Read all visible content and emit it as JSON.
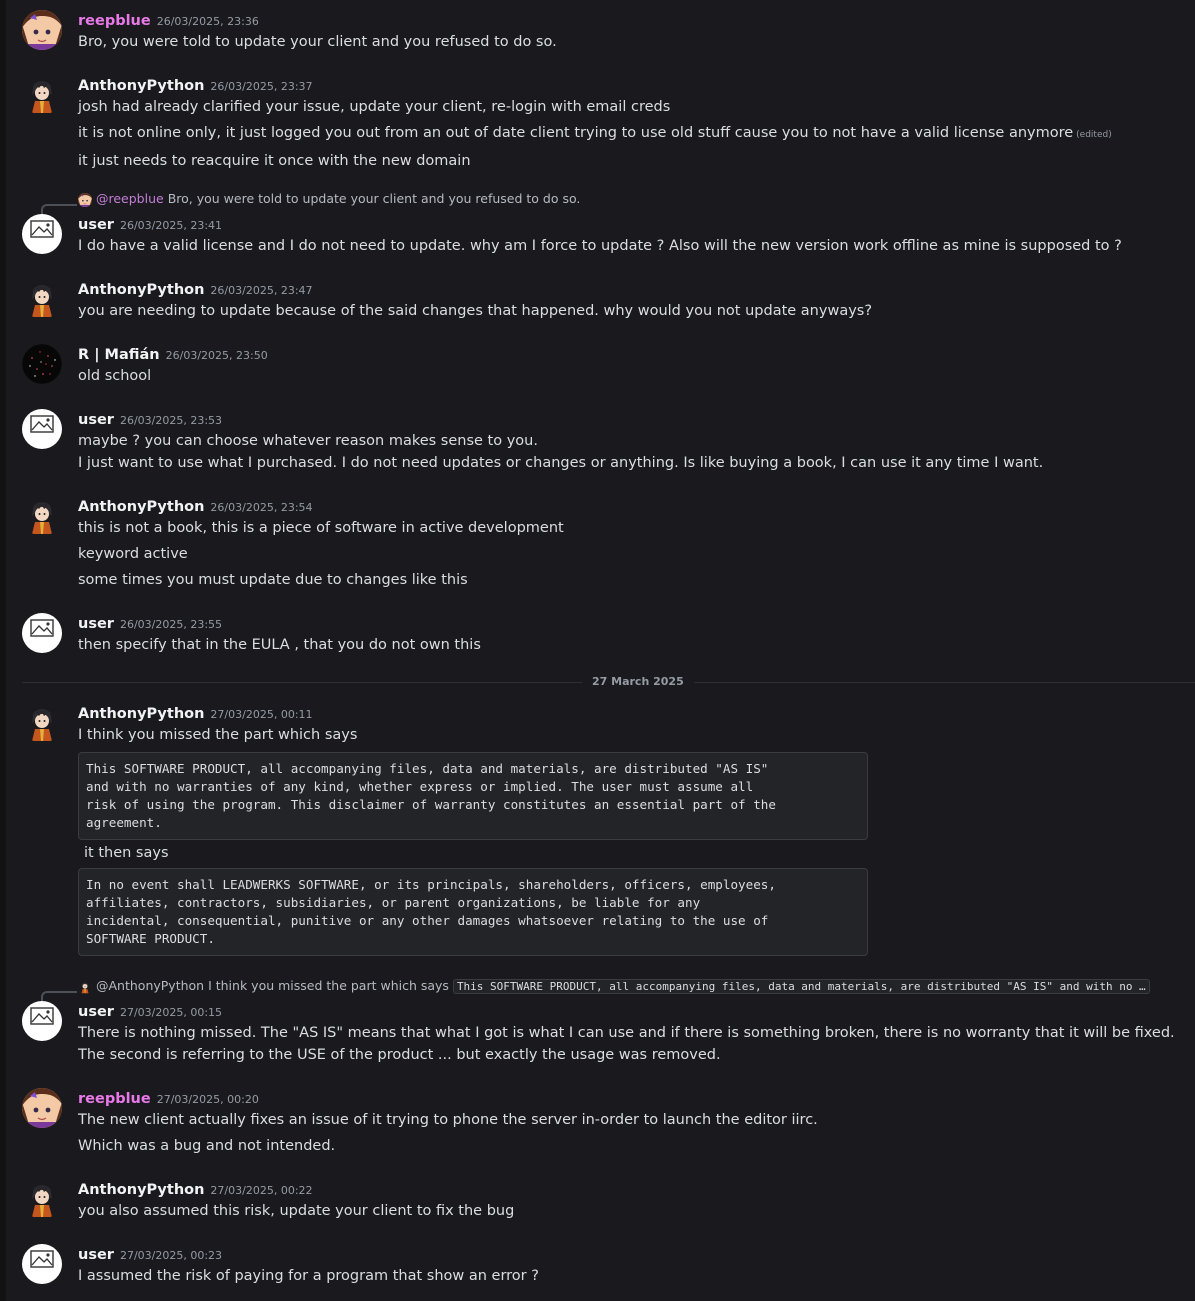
{
  "users": {
    "reepblue": "reepblue",
    "anthony": "AnthonyPython",
    "user": "user",
    "mafian": "R | Mafián"
  },
  "no_image_text": "No image available",
  "messages": [
    {
      "ts": "26/03/2025, 23:36",
      "lines": [
        "Bro, you were told to update your client and you refused to do so."
      ]
    },
    {
      "ts": "26/03/2025, 23:37",
      "lines": [
        "josh had already clarified your issue, update your client, re-login with email creds",
        "it is not online only, it just logged you out from an out of date client trying to use old stuff cause you to not have a valid license anymore",
        "it just needs to reacquire it once with the new domain"
      ],
      "edited": "(edited)"
    },
    {
      "ts": "26/03/2025, 23:41",
      "reply_to": "@reepblue",
      "reply_text": "Bro, you were told to update your client and you refused to do so.",
      "lines": [
        "I do have a valid license and I do not need to update. why am I force to update ? Also will the new version work offline as mine is supposed to ?"
      ]
    },
    {
      "ts": "26/03/2025, 23:47",
      "lines": [
        "you are needing to update because of the said changes that happened.  why would you not update anyways?"
      ]
    },
    {
      "ts": "26/03/2025, 23:50",
      "lines": [
        "old school"
      ]
    },
    {
      "ts": "26/03/2025, 23:53",
      "lines": [
        "maybe ? you can choose whatever reason makes sense to you.",
        "I just want to use what I purchased. I do not need updates or changes or anything. Is like buying a book, I can use it any time I want."
      ]
    },
    {
      "ts": "26/03/2025, 23:54",
      "lines": [
        "this is not a book, this is a piece of software in active development",
        "keyword active",
        "some times you must update due to changes like this"
      ]
    },
    {
      "ts": "26/03/2025, 23:55",
      "lines": [
        "then specify that in the EULA , that you do not own this"
      ]
    },
    {
      "ts": "27/03/2025, 00:11",
      "lines": [
        "I think you missed the part which says",
        "it then says"
      ],
      "code1": "This SOFTWARE PRODUCT, all accompanying files, data and materials, are distributed \"AS IS\"\nand with no warranties of any kind, whether express or implied. The user must assume all\nrisk of using the program. This disclaimer of warranty constitutes an essential part of the\nagreement.",
      "code2": "In no event shall LEADWERKS SOFTWARE, or its principals, shareholders, officers, employees,\naffiliates, contractors, subsidiaries, or parent organizations, be liable for any\nincidental, consequential, punitive or any other damages whatsoever relating to the use of\nSOFTWARE PRODUCT."
    },
    {
      "ts": "27/03/2025, 00:15",
      "reply_to": "@AnthonyPython",
      "reply_text": "I think you missed the part which says",
      "reply_code": "This SOFTWARE PRODUCT, all accompanying files, data and materials, are distributed \"AS IS\" and with no …",
      "lines": [
        "There is nothing missed. The \"AS IS\"  means that what I got is what I can use and if there is something broken, there is no worranty that it will be fixed.",
        "The second is referring to the USE of the product ... but exactly the usage was removed."
      ]
    },
    {
      "ts": "27/03/2025, 00:20",
      "lines": [
        "The new client actually fixes an issue of it trying to phone the server in-order to launch the editor iirc.",
        "Which was a bug and not intended."
      ]
    },
    {
      "ts": "27/03/2025, 00:22",
      "lines": [
        "you also assumed this risk, update your client to fix the bug"
      ]
    },
    {
      "ts": "27/03/2025, 00:23",
      "lines": [
        "I assumed the risk of paying for a program that show an error ?"
      ]
    }
  ],
  "date_divider": "27 March 2025",
  "colors": {
    "background": "#1a1a1e",
    "reepblue_name": "#e879e8",
    "mention": "#c27dd6"
  }
}
